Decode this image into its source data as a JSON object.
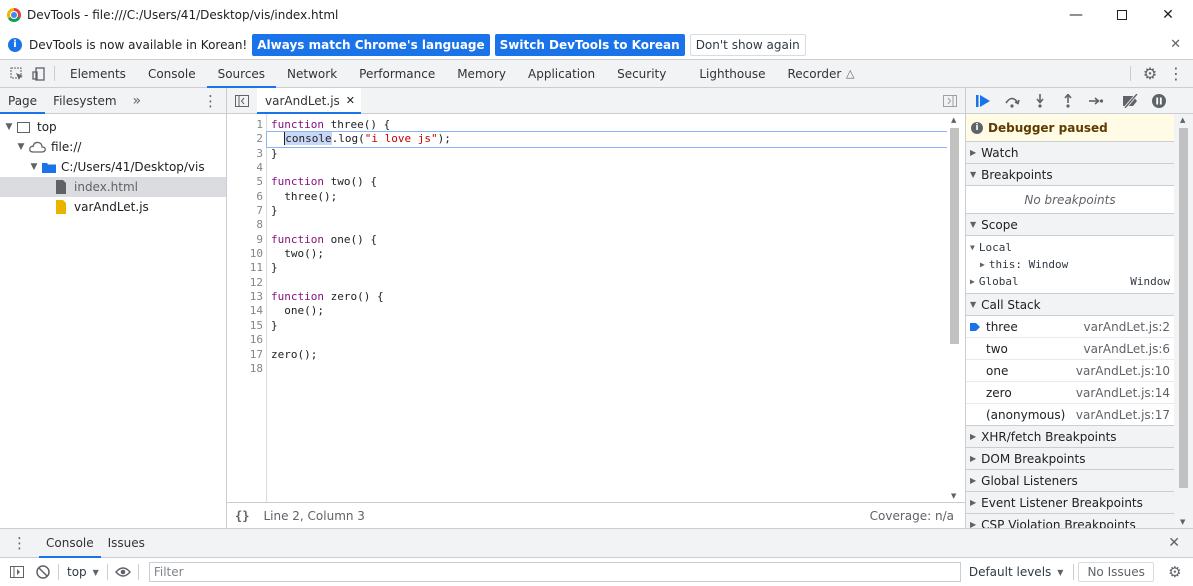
{
  "window": {
    "title": "DevTools - file:///C:/Users/41/Desktop/vis/index.html"
  },
  "infobar": {
    "message": "DevTools is now available in Korean!",
    "btn_match": "Always match Chrome's language",
    "btn_switch": "Switch DevTools to Korean",
    "btn_dont": "Don't show again"
  },
  "tabs": [
    "Elements",
    "Console",
    "Sources",
    "Network",
    "Performance",
    "Memory",
    "Application",
    "Security",
    "Lighthouse",
    "Recorder"
  ],
  "navigator": {
    "tabs": [
      "Page",
      "Filesystem"
    ],
    "tree": {
      "top": "top",
      "origin": "file://",
      "folder": "C:/Users/41/Desktop/vis",
      "file1": "index.html",
      "file2": "varAndLet.js"
    }
  },
  "editor": {
    "tab": "varAndLet.js",
    "lines": [
      "1",
      "2",
      "3",
      "4",
      "5",
      "6",
      "7",
      "8",
      "9",
      "10",
      "11",
      "12",
      "13",
      "14",
      "15",
      "16",
      "17",
      "18"
    ],
    "status_pos": "Line 2, Column 3",
    "coverage": "Coverage: n/a",
    "format": "{}"
  },
  "debugger": {
    "paused": "Debugger paused",
    "watch": "Watch",
    "breakpoints": "Breakpoints",
    "no_breakpoints": "No breakpoints",
    "scope": "Scope",
    "local": "Local",
    "this": "this: Window",
    "global": "Global",
    "global_val": "Window",
    "call_stack": "Call Stack",
    "frames": [
      {
        "fn": "three",
        "loc": "varAndLet.js:2"
      },
      {
        "fn": "two",
        "loc": "varAndLet.js:6"
      },
      {
        "fn": "one",
        "loc": "varAndLet.js:10"
      },
      {
        "fn": "zero",
        "loc": "varAndLet.js:14"
      },
      {
        "fn": "(anonymous)",
        "loc": "varAndLet.js:17"
      }
    ],
    "xhr": "XHR/fetch Breakpoints",
    "dom": "DOM Breakpoints",
    "global_listeners": "Global Listeners",
    "event_listeners": "Event Listener Breakpoints",
    "csp": "CSP Violation Breakpoints"
  },
  "drawer": {
    "tabs": [
      "Console",
      "Issues"
    ],
    "context": "top",
    "filter_placeholder": "Filter",
    "levels": "Default levels",
    "issues": "No Issues"
  }
}
